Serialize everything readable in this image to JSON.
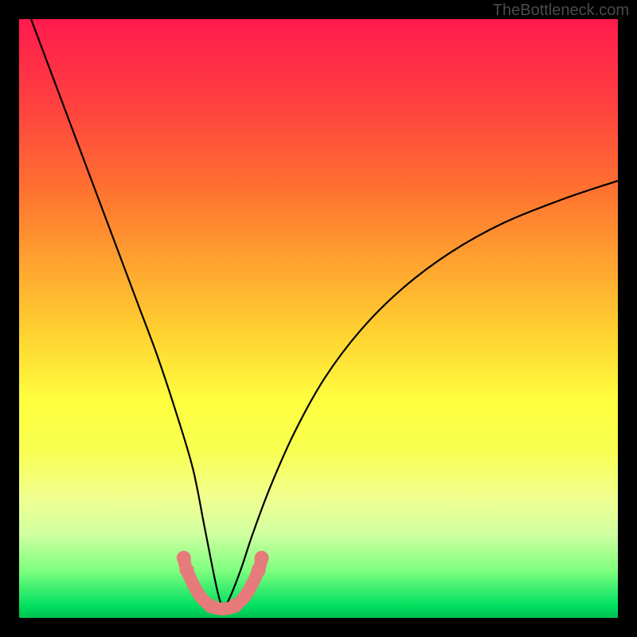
{
  "attribution": "TheBottleneck.com",
  "chart_data": {
    "type": "line",
    "title": "",
    "xlabel": "",
    "ylabel": "",
    "xlim": [
      0,
      100
    ],
    "ylim": [
      0,
      100
    ],
    "background_gradient": {
      "top": "#ff1a4d",
      "bottom": "#00c050",
      "description": "vertical rainbow gradient red→orange→yellow→green"
    },
    "series": [
      {
        "name": "bottleneck-curve",
        "description": "V-shaped absolute-value-like curve. Left branch descends steeply from top-left to a minimum near x≈34 y≈0, right branch rises with decreasing slope toward upper right.",
        "x": [
          2,
          5,
          8,
          11,
          14,
          17,
          20,
          23,
          26,
          29,
          31,
          33,
          34,
          35,
          37,
          39,
          42,
          46,
          51,
          57,
          64,
          72,
          81,
          91,
          100
        ],
        "y": [
          100,
          92,
          84,
          76,
          68,
          60,
          52,
          44,
          35,
          25,
          15,
          5,
          2,
          3,
          8,
          14,
          22,
          31,
          40,
          48,
          55,
          61,
          66,
          70,
          73
        ],
        "stroke": "#000000"
      },
      {
        "name": "marker-band",
        "description": "pink rounded segments near the curve minimum",
        "points": [
          {
            "x": 27.5,
            "y": 10
          },
          {
            "x": 28.0,
            "y": 8
          },
          {
            "x": 30.0,
            "y": 4
          },
          {
            "x": 32.0,
            "y": 2
          },
          {
            "x": 34.0,
            "y": 1.5
          },
          {
            "x": 36.0,
            "y": 2
          },
          {
            "x": 38.0,
            "y": 4
          },
          {
            "x": 40.0,
            "y": 8
          },
          {
            "x": 40.5,
            "y": 10
          }
        ],
        "color": "#e77a7a"
      }
    ]
  }
}
